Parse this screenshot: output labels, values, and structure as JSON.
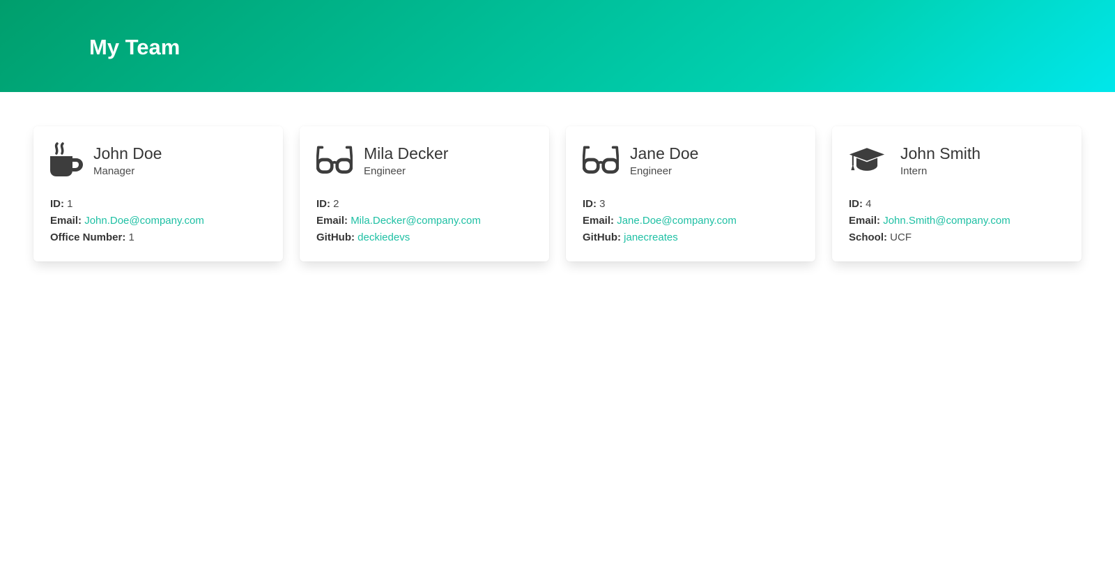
{
  "header": {
    "title": "My Team"
  },
  "accent_color": "#1fc0a4",
  "cards": [
    {
      "name": "John Doe",
      "role": "Manager",
      "icon": "coffee-mug-icon",
      "id_label": "ID:",
      "id": "1",
      "email_label": "Email:",
      "email": "John.Doe@company.com",
      "extra_label": "Office Number:",
      "extra": "1"
    },
    {
      "name": "Mila Decker",
      "role": "Engineer",
      "icon": "glasses-icon",
      "id_label": "ID:",
      "id": "2",
      "email_label": "Email:",
      "email": "Mila.Decker@company.com",
      "extra_label": "GitHub:",
      "extra": "deckiedevs"
    },
    {
      "name": "Jane Doe",
      "role": "Engineer",
      "icon": "glasses-icon",
      "id_label": "ID:",
      "id": "3",
      "email_label": "Email:",
      "email": "Jane.Doe@company.com",
      "extra_label": "GitHub:",
      "extra": "janecreates"
    },
    {
      "name": "John Smith",
      "role": "Intern",
      "icon": "graduation-cap-icon",
      "id_label": "ID:",
      "id": "4",
      "email_label": "Email:",
      "email": "John.Smith@company.com",
      "extra_label": "School:",
      "extra": "UCF"
    }
  ]
}
